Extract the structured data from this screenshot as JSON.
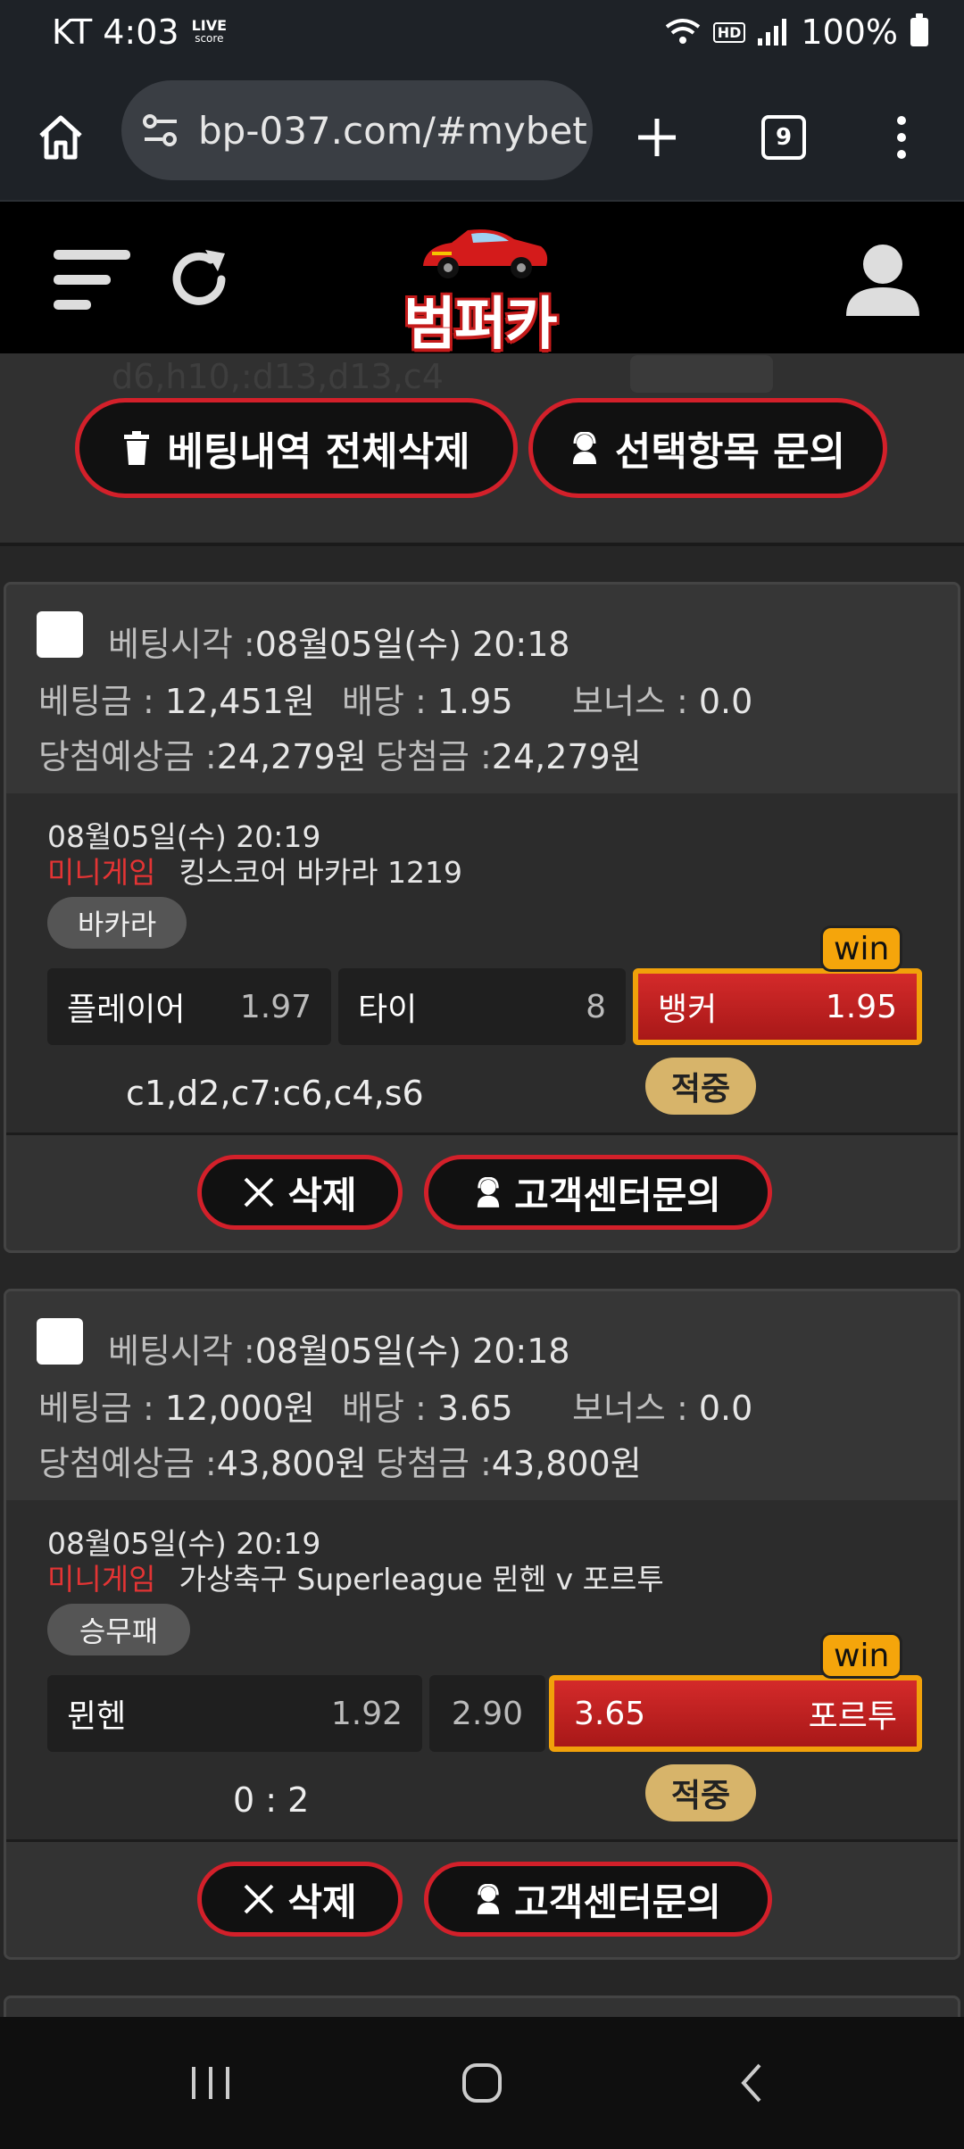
{
  "status_bar": {
    "carrier_time": "KT 4:03",
    "live_logo": "LIVE",
    "live_logo_sub": "score",
    "hd": "HD",
    "battery": "100%"
  },
  "browser": {
    "url": "bp-037.com/#mybet",
    "tab_count": "9"
  },
  "site": {
    "logo_text": "범퍼카"
  },
  "actions": {
    "ghost_text": "d6,h10,:d13,d13,c4",
    "delete_all": "베팅내역 전체삭제",
    "inquire_selected": "선택항목 문의"
  },
  "labels": {
    "bet_time": "베팅시각 :",
    "bet_amount": "베팅금 :",
    "odds": "배당 :",
    "bonus": "보너스 :",
    "expected": "당첨예상금 :",
    "won": "당첨금 :",
    "win": "win",
    "hit": "적중",
    "delete": "삭제",
    "support": "고객센터문의"
  },
  "bets": [
    {
      "bet_time": "08월05일(수) 20:18",
      "amount": "12,451원",
      "odds": "1.95",
      "bonus": "0.0",
      "expected": "24,279원",
      "won": "24,279원",
      "game_time": "08월05일(수) 20:19",
      "category": "미니게임",
      "game": "킹스코어 바카라 1219",
      "type": "바카라",
      "options": [
        {
          "name": "플레이어",
          "odds": "1.97"
        },
        {
          "name": "타이",
          "odds": "8"
        },
        {
          "name": "뱅커",
          "odds": "1.95"
        }
      ],
      "result": "c1,d2,c7:c6,c4,s6"
    },
    {
      "bet_time": "08월05일(수) 20:18",
      "amount": "12,000원",
      "odds": "3.65",
      "bonus": "0.0",
      "expected": "43,800원",
      "won": "43,800원",
      "game_time": "08월05일(수) 20:19",
      "category": "미니게임",
      "game": "가상축구 Superleague 뮌헨 v 포르투",
      "type": "승무패",
      "options": [
        {
          "name": "뮌헨",
          "odds": "1.92"
        },
        {
          "name": "",
          "odds": "2.90"
        },
        {
          "name": "포르투",
          "odds": "3.65"
        }
      ],
      "result": "0 : 2"
    }
  ]
}
